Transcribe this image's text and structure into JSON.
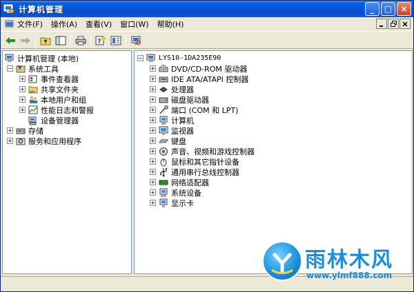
{
  "window": {
    "title": "计算机管理"
  },
  "title_buttons": {
    "minimize": "_",
    "maximize": "□",
    "close": "×"
  },
  "menu": [
    {
      "label": "文件(F)"
    },
    {
      "label": "操作(A)"
    },
    {
      "label": "查看(V)"
    },
    {
      "label": "窗口(W)"
    },
    {
      "label": "帮助(H)"
    }
  ],
  "left_tree": {
    "root": "计算机管理 (本地)",
    "items": [
      {
        "label": "系统工具",
        "expander": "−"
      },
      {
        "label": "事件查看器",
        "expander": "+"
      },
      {
        "label": "共享文件夹",
        "expander": "+"
      },
      {
        "label": "本地用户和组",
        "expander": "+"
      },
      {
        "label": "性能日志和警报",
        "expander": "+"
      },
      {
        "label": "设备管理器",
        "expander": ""
      },
      {
        "label": "存储",
        "expander": "+"
      },
      {
        "label": "服务和应用程序",
        "expander": "+"
      }
    ]
  },
  "right_tree": {
    "root": "LYS10-1DA235E90",
    "devices": [
      {
        "label": "DVD/CD-ROM 驱动器",
        "icon": "cdrom-icon"
      },
      {
        "label": "IDE ATA/ATAPI 控制器",
        "icon": "ide-controller-icon"
      },
      {
        "label": "处理器",
        "icon": "processor-icon"
      },
      {
        "label": "磁盘驱动器",
        "icon": "disk-drive-icon"
      },
      {
        "label": "端口 (COM 和 LPT)",
        "icon": "port-icon"
      },
      {
        "label": "计算机",
        "icon": "computer-icon"
      },
      {
        "label": "监视器",
        "icon": "monitor-icon"
      },
      {
        "label": "键盘",
        "icon": "keyboard-icon"
      },
      {
        "label": "声音、视频和游戏控制器",
        "icon": "sound-icon"
      },
      {
        "label": "鼠标和其它指针设备",
        "icon": "mouse-icon"
      },
      {
        "label": "通用串行总线控制器",
        "icon": "usb-icon"
      },
      {
        "label": "网络适配器",
        "icon": "network-adapter-icon"
      },
      {
        "label": "系统设备",
        "icon": "system-device-icon"
      },
      {
        "label": "显示卡",
        "icon": "display-adapter-icon"
      }
    ]
  },
  "watermark": {
    "text": "雨林木风",
    "url": "www.ylmf888.com"
  },
  "colors": {
    "titlebar": "#0553d9",
    "face": "#ece9d8",
    "watermark": "#1a8fd8"
  }
}
